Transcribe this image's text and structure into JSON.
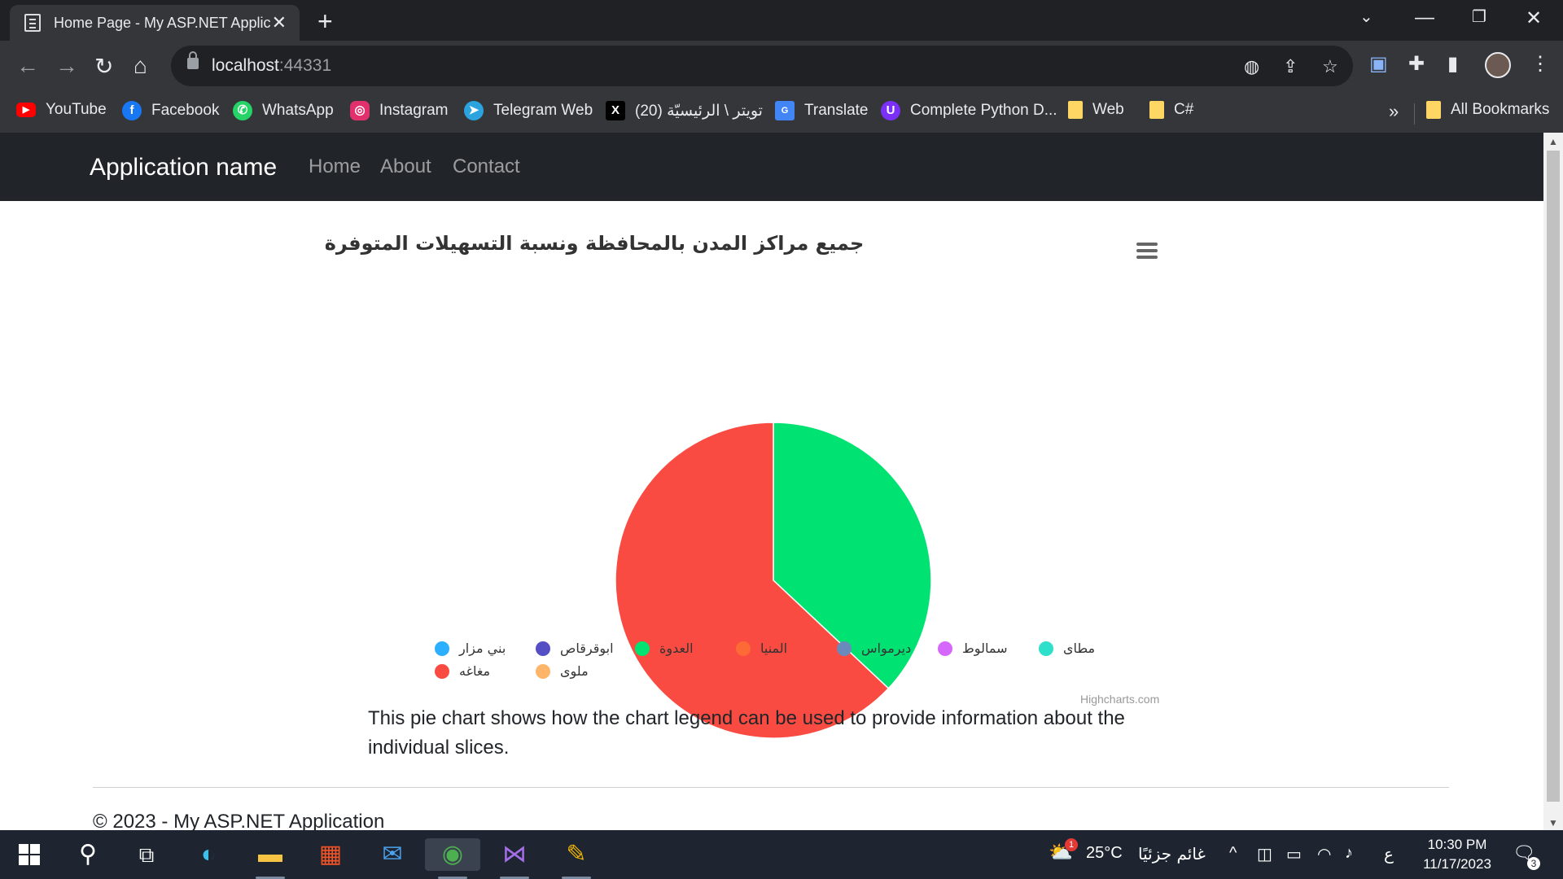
{
  "browser": {
    "tab_title": "Home Page - My ASP.NET Applic",
    "url_host": "localhost",
    "url_port": ":44331",
    "bookmarks": [
      {
        "label": "YouTube",
        "color": "#ff0000"
      },
      {
        "label": "Facebook",
        "color": "#1877f2"
      },
      {
        "label": "WhatsApp",
        "color": "#25d366"
      },
      {
        "label": "Instagram",
        "color": "#e1306c"
      },
      {
        "label": "Telegram Web",
        "color": "#2aa3df"
      },
      {
        "label": "(20) تويتر \\ الرئيسيّة",
        "color": "#000000"
      },
      {
        "label": "Translate",
        "color": "#4285f4"
      },
      {
        "label": "Complete Python D...",
        "color": "#7b2ff7"
      },
      {
        "label": "Web",
        "color": "#fdd663"
      },
      {
        "label": "C#",
        "color": "#fdd663"
      }
    ],
    "all_bookmarks": "All Bookmarks"
  },
  "app": {
    "brand": "Application name",
    "nav": [
      "Home",
      "About",
      "Contact"
    ]
  },
  "chart_data": {
    "type": "pie",
    "title": "جميع مراكز المدن بالمحافظة ونسبة التسهيلات المتوفرة",
    "series": [
      {
        "name": "بني مزار",
        "value": 0,
        "color": "#2caffe"
      },
      {
        "name": "ابوقرقاص",
        "value": 0,
        "color": "#544fc5"
      },
      {
        "name": "العدوة",
        "value": 37,
        "color": "#00e272"
      },
      {
        "name": "المنيا",
        "value": 0,
        "color": "#fe6a35"
      },
      {
        "name": "ديرمواس",
        "value": 0,
        "color": "#6b8abc"
      },
      {
        "name": "سمالوط",
        "value": 0,
        "color": "#d568fb"
      },
      {
        "name": "مطاى",
        "value": 0,
        "color": "#2ee0ca"
      },
      {
        "name": "مغاغه",
        "value": 63,
        "color": "#fa4b42"
      },
      {
        "name": "ملوى",
        "value": 0,
        "color": "#feb56a"
      }
    ],
    "credits": "Highcharts.com"
  },
  "content": {
    "description": "This pie chart shows how the chart legend can be used to provide information about the individual slices.",
    "footer": "© 2023 - My ASP.NET Application"
  },
  "taskbar": {
    "weather_temp": "25°C",
    "weather_text": "غائم جزئيًا",
    "input_lang": "ع",
    "time": "10:30 PM",
    "date": "11/17/2023",
    "notifications": "3",
    "weather_badge": "1"
  }
}
